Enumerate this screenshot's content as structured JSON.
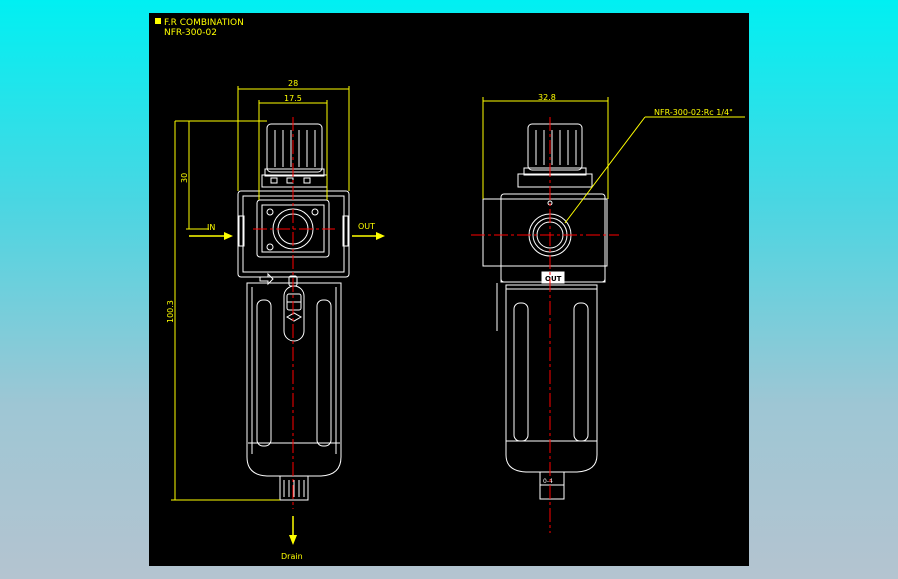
{
  "title": {
    "line1": "F.R  COMBINATION",
    "line2": "NFR-300-02"
  },
  "dimensions": {
    "width_total": "28",
    "width_port_block": "17.5",
    "width_side": "32.8",
    "height_upper": "30",
    "height_lower": "100.3"
  },
  "labels": {
    "inlet": "IN",
    "outlet": "OUT",
    "drain": "Drain",
    "port_note": "NFR-300-02:Rc 1/4\"",
    "out_plate": "OUT",
    "gauge_mark": "0-4"
  },
  "colors": {
    "background_drawing": "#000000",
    "outline": "#ffffff",
    "dimension": "#ffff00",
    "centerline": "#ff0000",
    "title_marker": "#ffff00"
  }
}
